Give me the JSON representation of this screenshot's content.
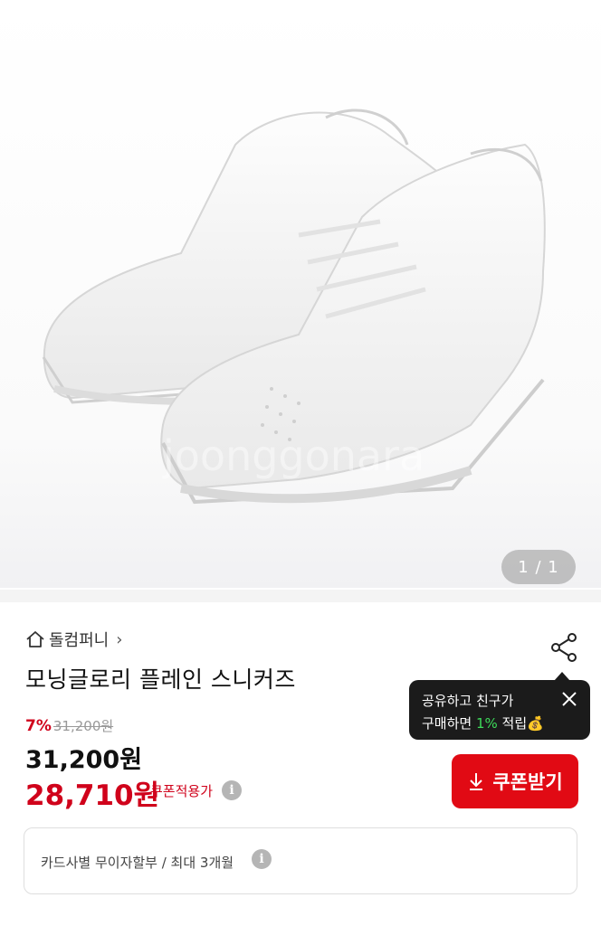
{
  "gallery": {
    "counter": "1 / 1",
    "watermark": "joonggonara"
  },
  "product": {
    "brand": "돌컴퍼니",
    "title": "모닝글로리 플레인 스니커즈",
    "discount_percent": "7%",
    "original_price": "31,200원",
    "price": "31,200원",
    "coupon_price": "28,710원",
    "coupon_label": "쿠폰적용가"
  },
  "tooltip": {
    "line1": "공유하고 친구가",
    "line2_prefix": "구매하면 ",
    "line2_highlight": "1%",
    "line2_suffix": " 적립",
    "emoji": "💰"
  },
  "coupon_button": {
    "label": "쿠폰받기"
  },
  "installment": {
    "text": "카드사별 무이자할부 / 최대 3개월"
  },
  "icons": {
    "info": "i"
  },
  "colors": {
    "accent": "#e10a14",
    "price_red": "#d0021b",
    "tooltip_bg": "#1b1b1b",
    "highlight_green": "#3ddb5a"
  }
}
